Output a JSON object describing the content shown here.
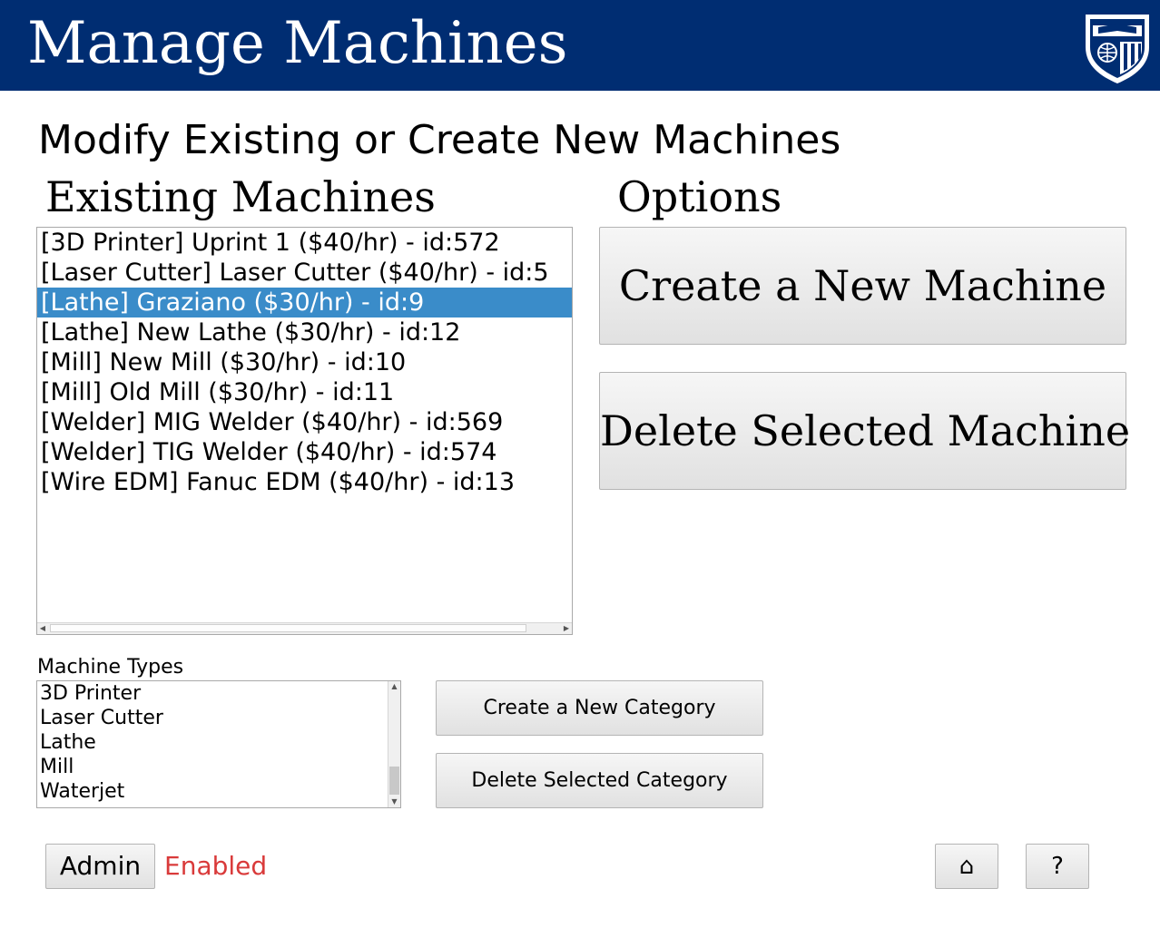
{
  "header": {
    "title": "Manage Machines",
    "background_color": "#002d72",
    "logo_icon": "university-shield-logo"
  },
  "page": {
    "subtitle": "Modify Existing or Create New Machines"
  },
  "existing_machines": {
    "label": "Existing Machines",
    "selected_index": 2,
    "selection_color": "#3a8cc9",
    "items": [
      "[3D Printer] Uprint 1 ($40/hr) - id:572",
      "[Laser Cutter] Laser Cutter ($40/hr) - id:5",
      "[Lathe] Graziano ($30/hr) - id:9",
      "[Lathe] New Lathe ($30/hr) - id:12",
      "[Mill] New Mill ($30/hr) - id:10",
      "[Mill] Old Mill ($30/hr) - id:11",
      "[Welder] MIG Welder ($40/hr) - id:569",
      "[Welder] TIG Welder ($40/hr) - id:574",
      "[Wire EDM] Fanuc EDM ($40/hr) - id:13"
    ]
  },
  "options": {
    "label": "Options",
    "create_machine_label": "Create a New Machine",
    "delete_machine_label": "Delete Selected Machine"
  },
  "machine_types": {
    "label": "Machine Types",
    "items": [
      "3D Printer",
      "Laser Cutter",
      "Lathe",
      "Mill",
      "Waterjet"
    ],
    "create_category_label": "Create a New Category",
    "delete_category_label": "Delete Selected Category"
  },
  "footer": {
    "admin_label": "Admin",
    "admin_status": "Enabled",
    "admin_status_color": "#d93a3a",
    "home_icon": "⌂",
    "help_label": "?"
  }
}
